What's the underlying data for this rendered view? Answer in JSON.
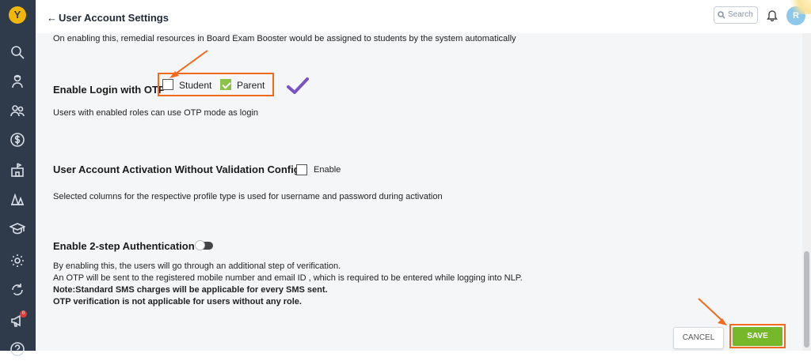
{
  "app": {
    "logo_letter": "Y"
  },
  "sidebar": {
    "items": [
      {
        "icon": "search-icon"
      },
      {
        "icon": "student-icon"
      },
      {
        "icon": "users-icon"
      },
      {
        "icon": "dollar-icon"
      },
      {
        "icon": "institution-icon"
      },
      {
        "icon": "apps-icon"
      },
      {
        "icon": "graduation-cap-icon"
      },
      {
        "icon": "gear-icon"
      },
      {
        "icon": "refresh-icon"
      },
      {
        "icon": "megaphone-icon"
      },
      {
        "icon": "help-icon"
      }
    ],
    "notification_count": "0"
  },
  "header": {
    "back_arrow": "←",
    "title": "User Account Settings",
    "search_placeholder": "Search",
    "avatar_initial": "R"
  },
  "content": {
    "remedial_desc": "On enabling this, remedial resources in Board Exam Booster would be assigned to students by the system automatically",
    "otp": {
      "heading": "Enable Login with OTP",
      "options": [
        {
          "label": "Student",
          "checked": false
        },
        {
          "label": "Parent",
          "checked": true
        }
      ],
      "desc": "Users with enabled roles can use OTP mode as login"
    },
    "activation": {
      "heading": "User Account Activation Without Validation Config",
      "option_label": "Enable",
      "checked": false,
      "desc": "Selected columns for the respective profile type is used for username and password during activation"
    },
    "two_step": {
      "heading": "Enable 2-step Authentication",
      "enabled": false,
      "lines": [
        "By enabling this, the users will go through an additional step of verification.",
        "An OTP will be sent to the registered mobile number and email ID , which is required to be entered while logging into NLP."
      ],
      "notes": [
        "Note:Standard SMS charges will be applicable for every SMS sent.",
        "OTP verification is not applicable for users without any role."
      ]
    }
  },
  "footer": {
    "cancel_label": "CANCEL",
    "save_label": "SAVE"
  },
  "colors": {
    "sidebar": "#2f3a4a",
    "accent_green": "#76b82a",
    "annotation_orange": "#f26b1d",
    "checkmark_purple": "#7b52c4"
  }
}
